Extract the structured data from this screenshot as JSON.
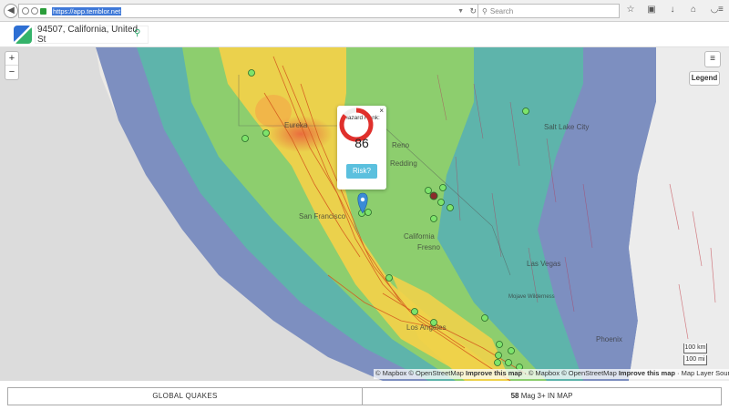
{
  "browser": {
    "url": "https://app.temblor.net",
    "search_placeholder": "Search",
    "icons": [
      "back-icon",
      "info-icon",
      "shield-icon",
      "lock-icon",
      "star-icon",
      "clipboard-icon",
      "download-icon",
      "home-icon",
      "pocket-icon",
      "menu-icon"
    ]
  },
  "header": {
    "location": "94507, California, United St"
  },
  "map": {
    "zoom_in": "+",
    "zoom_out": "−",
    "legend_label": "Legend",
    "place_labels": [
      "Eureka",
      "Redding",
      "San Francisco",
      "California",
      "Fresno",
      "Reno",
      "Las Vegas",
      "Los Angeles",
      "Phoenix",
      "Salt Lake City",
      "Mojave Wilderness"
    ],
    "scale": {
      "km": "100 km",
      "mi": "100 mi"
    },
    "attribution": {
      "part1": "© Mapbox © OpenStreetMap",
      "improve1": "Improve this map",
      "part2": "· © Mapbox © OpenStreetMap",
      "improve2": "Improve this map",
      "part3": "· Map Layer Sources"
    },
    "colors": {
      "high": "#e9543a",
      "med_high": "#f3c64e",
      "medium": "#9fd86a",
      "low": "#5bc0a8",
      "lowest": "#6a7fb8"
    }
  },
  "popup": {
    "title": "Hazard Rank:",
    "value": "86",
    "risk_button": "Risk?",
    "close": "×"
  },
  "bottom": {
    "global_quakes": "GLOBAL QUAKES",
    "count": "58",
    "count_label": "Mag 3+ IN MAP"
  }
}
